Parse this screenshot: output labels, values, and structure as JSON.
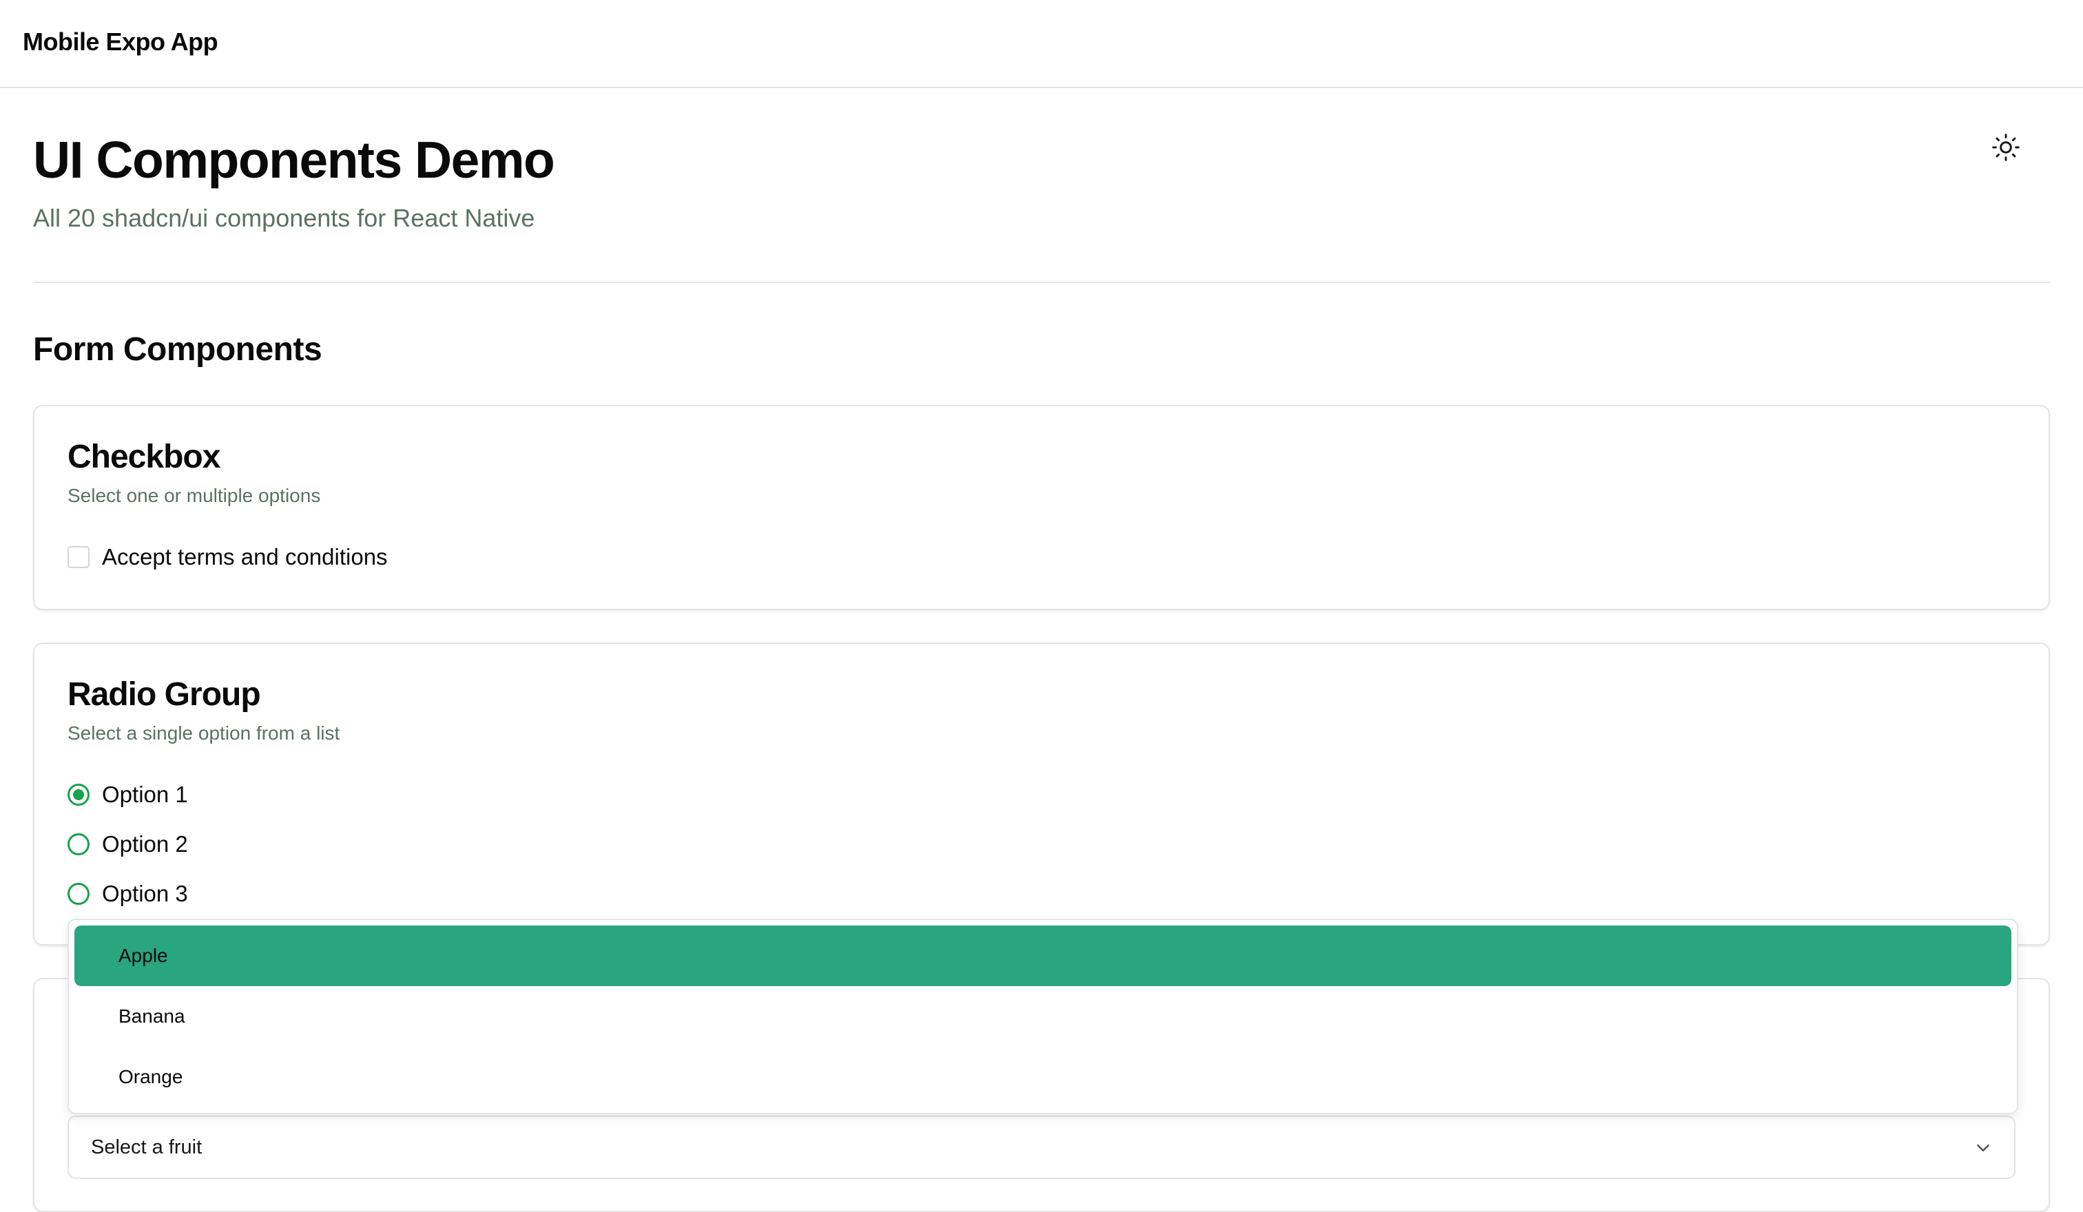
{
  "app": {
    "title": "Mobile Expo App"
  },
  "header": {
    "title": "UI Components Demo",
    "subtitle": "All 20 shadcn/ui components for React Native",
    "theme_icon": "sun-icon"
  },
  "section": {
    "title": "Form Components"
  },
  "checkbox_card": {
    "title": "Checkbox",
    "description": "Select one or multiple options",
    "option": {
      "label": "Accept terms and conditions",
      "checked": false
    }
  },
  "radio_card": {
    "title": "Radio Group",
    "description": "Select a single option from a list",
    "options": [
      {
        "label": "Option 1",
        "selected": true
      },
      {
        "label": "Option 2",
        "selected": false
      },
      {
        "label": "Option 3",
        "selected": false
      }
    ]
  },
  "select": {
    "placeholder": "Select a fruit",
    "options": [
      "Apple",
      "Banana",
      "Orange"
    ],
    "highlighted": "Apple",
    "icon": "chevron-down-icon"
  },
  "colors": {
    "accent": "#16a34a",
    "highlight": "#29a57f",
    "muted_text": "#5b7163",
    "border": "#e4e4e7"
  }
}
